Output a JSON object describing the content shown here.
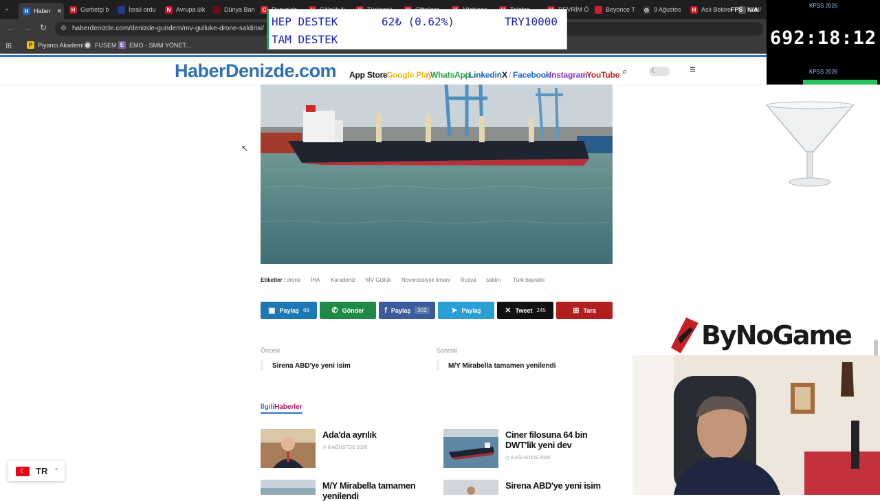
{
  "browser": {
    "tabs": [
      {
        "label": "Haber",
        "color": "#1e63c9",
        "glyph": "H",
        "active": true
      },
      {
        "label": "Gurbetçi b",
        "color": "#c0161d",
        "glyph": "H"
      },
      {
        "label": "İsrail ordu",
        "color": "#233a8c",
        "glyph": ""
      },
      {
        "label": "Avrupa ülk",
        "color": "#c8102e",
        "glyph": "N"
      },
      {
        "label": "Dünya Ban",
        "color": "#6b0f13",
        "glyph": ""
      },
      {
        "label": "Rusya'da",
        "color": "#d21e2b",
        "glyph": "C"
      },
      {
        "label": "Gölcük ili",
        "color": "#c0161d",
        "glyph": "H"
      },
      {
        "label": "Türkcanlı",
        "color": "#c0161d",
        "glyph": "H"
      },
      {
        "label": "Çiftçilere",
        "color": "#c0161d",
        "glyph": "H"
      },
      {
        "label": "Michigan",
        "color": "#c91f3c",
        "glyph": "Y"
      },
      {
        "label": "Telefon",
        "color": "#c0161d",
        "glyph": "H"
      },
      {
        "label": "DEVRİM Ö",
        "color": "#c0161d",
        "glyph": "H"
      },
      {
        "label": "Beyonce T",
        "color": "#d21e2b",
        "glyph": ""
      },
      {
        "label": "9 Ağustos",
        "color": "#333333",
        "glyph": "◎"
      },
      {
        "label": "Aslı Bekiro",
        "color": "#c0161d",
        "glyph": "H"
      },
      {
        "label": "...el/",
        "color": "#555555",
        "glyph": ""
      }
    ],
    "url": "haberdenizde.com/denizde-gundem/mv-gulluke-drone-saldirisi/",
    "bookmarks": [
      "Piyancı Akademi",
      "FUSEM",
      "EMO - SMM YÖNET..."
    ],
    "fps_label": "FPS",
    "fps_value": "N/A"
  },
  "overlay": {
    "ticker_line1_left": "HEP DESTEK",
    "ticker_line1_mid": "62₺ (0.62%)",
    "ticker_line1_right": "TRY10000",
    "ticker_line2": "TAM DESTEK",
    "timer_top_label": "KPSS 2026",
    "timer_value": "692:18:12",
    "timer_bottom_label": "KPSS 2026",
    "brand": "ByNoGame"
  },
  "site": {
    "logo": "HaberDenizde.com",
    "nav": [
      {
        "label": "App Store",
        "color": "#111111"
      },
      {
        "label": "Google Play",
        "color": "#f2b61b"
      },
      {
        "label": "WhatsApp",
        "color": "#25a244"
      },
      {
        "label": "Linkedin",
        "color": "#1c66b5"
      },
      {
        "label": "X",
        "color": "#111111"
      },
      {
        "label": "Facebook",
        "color": "#1b66d6"
      },
      {
        "label": "Instagram",
        "color": "#8a2fbf"
      },
      {
        "label": "YouTube",
        "color": "#d31b1b"
      }
    ]
  },
  "article": {
    "tags_label": "Etiketler :",
    "tags": [
      "drone",
      "İHA",
      "Karadeniz",
      "MV Güllük",
      "Novorossiysk limanı",
      "Rusya",
      "saldırı",
      "Türk bayraklı"
    ],
    "share": [
      {
        "label": "Paylaş",
        "count": "69",
        "color": "#1b78b4",
        "icon": "in"
      },
      {
        "label": "Gönder",
        "count": "",
        "color": "#1f8a45",
        "icon": "wa"
      },
      {
        "label": "Paylaş",
        "count": "302",
        "color": "#3b5b9a",
        "icon": "f"
      },
      {
        "label": "Paylaş",
        "count": "",
        "color": "#2a9fd4",
        "icon": "tg"
      },
      {
        "label": "Tweet",
        "count": "245",
        "color": "#111111",
        "icon": "x"
      },
      {
        "label": "Tara",
        "count": "",
        "color": "#b21d1d",
        "icon": "qr"
      }
    ],
    "prev_label": "Önceki",
    "prev_title": "Sirena ABD'ye yeni isim",
    "next_label": "Sonraki",
    "next_title": "M/Y Mirabella tamamen yenilendi",
    "related_heading_a": "İlgili",
    "related_heading_b": "Haberler",
    "related": [
      {
        "title": "Ada'da ayrılık",
        "date": "8 AĞUSTOS 2026"
      },
      {
        "title": "Ciner filosuna 64 bin DWT'lik yeni dev",
        "date": "8 AĞUSTOS 2026"
      },
      {
        "title": "M/Y Mirabella tamamen yenilendi",
        "date": ""
      },
      {
        "title": "Sirena ABD'ye yeni isim",
        "date": ""
      }
    ]
  },
  "language": {
    "code": "TR"
  }
}
